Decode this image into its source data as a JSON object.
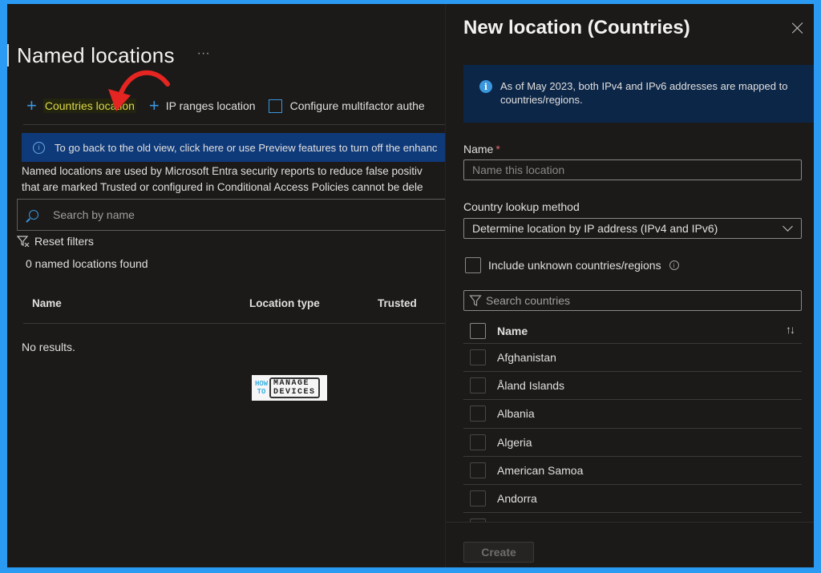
{
  "main": {
    "title": "Named locations",
    "more_label": "···",
    "toolbar": [
      {
        "label": "Countries location",
        "icon": "plus-icon",
        "highlighted": true
      },
      {
        "label": "IP ranges location",
        "icon": "plus-icon",
        "highlighted": false
      },
      {
        "label": "Configure multifactor authe",
        "icon": "external-link-icon",
        "highlighted": false
      }
    ],
    "banner": "To go back to the old view, click here or use Preview features to turn off the enhanc",
    "description_line1": "Named locations are used by Microsoft Entra security reports to reduce false positiv",
    "description_line2": "that are marked Trusted or configured in Conditional Access Policies cannot be dele",
    "search_placeholder": "Search by name",
    "reset_filters": "Reset filters",
    "count": "0 named locations found",
    "columns": [
      "Name",
      "Location type",
      "Trusted"
    ],
    "no_results": "No results.",
    "logo": {
      "how": "HOW",
      "to": "TO",
      "manage": "MANAGE",
      "devices": "DEVICES"
    }
  },
  "panel": {
    "title": "New location (Countries)",
    "info": "As of May 2023, both IPv4 and IPv6 addresses are mapped to countries/regions.",
    "name_label": "Name",
    "required_mark": "*",
    "name_placeholder": "Name this location",
    "lookup_label": "Country lookup method",
    "lookup_value": "Determine location by IP address (IPv4 and IPv6)",
    "include_unknown": "Include unknown countries/regions",
    "include_unknown_checked": false,
    "search_placeholder": "Search countries",
    "list_header": "Name",
    "sort_icon": "↑↓",
    "countries": [
      "Afghanistan",
      "Åland Islands",
      "Albania",
      "Algeria",
      "American Samoa",
      "Andorra"
    ],
    "create_label": "Create"
  },
  "colors": {
    "accent": "#3a96dd",
    "highlight_text": "#ddd94a",
    "banner_bg": "#0f3a7a",
    "info_bg": "#0c2648",
    "background": "#1b1a19",
    "outer_border": "#2b9af3"
  }
}
